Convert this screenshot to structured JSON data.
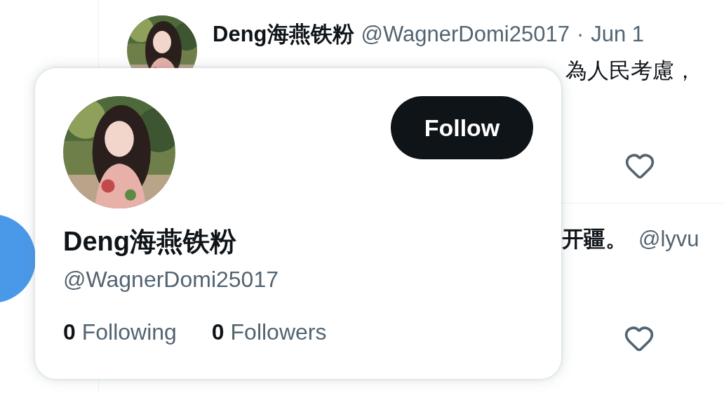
{
  "timeline": [
    {
      "author": "Deng海燕铁粉",
      "handle": "@WagnerDomi25017",
      "separator": "·",
      "date": "Jun 1",
      "text": "為人民考慮，",
      "liked": false
    },
    {
      "text": "开疆。",
      "mention": "@lyvu",
      "liked": false
    }
  ],
  "hover_card": {
    "name": "Deng海燕铁粉",
    "handle": "@WagnerDomi25017",
    "follow_button": "Follow",
    "stats": [
      {
        "count": "0",
        "label": "Following"
      },
      {
        "count": "0",
        "label": "Followers"
      }
    ]
  }
}
